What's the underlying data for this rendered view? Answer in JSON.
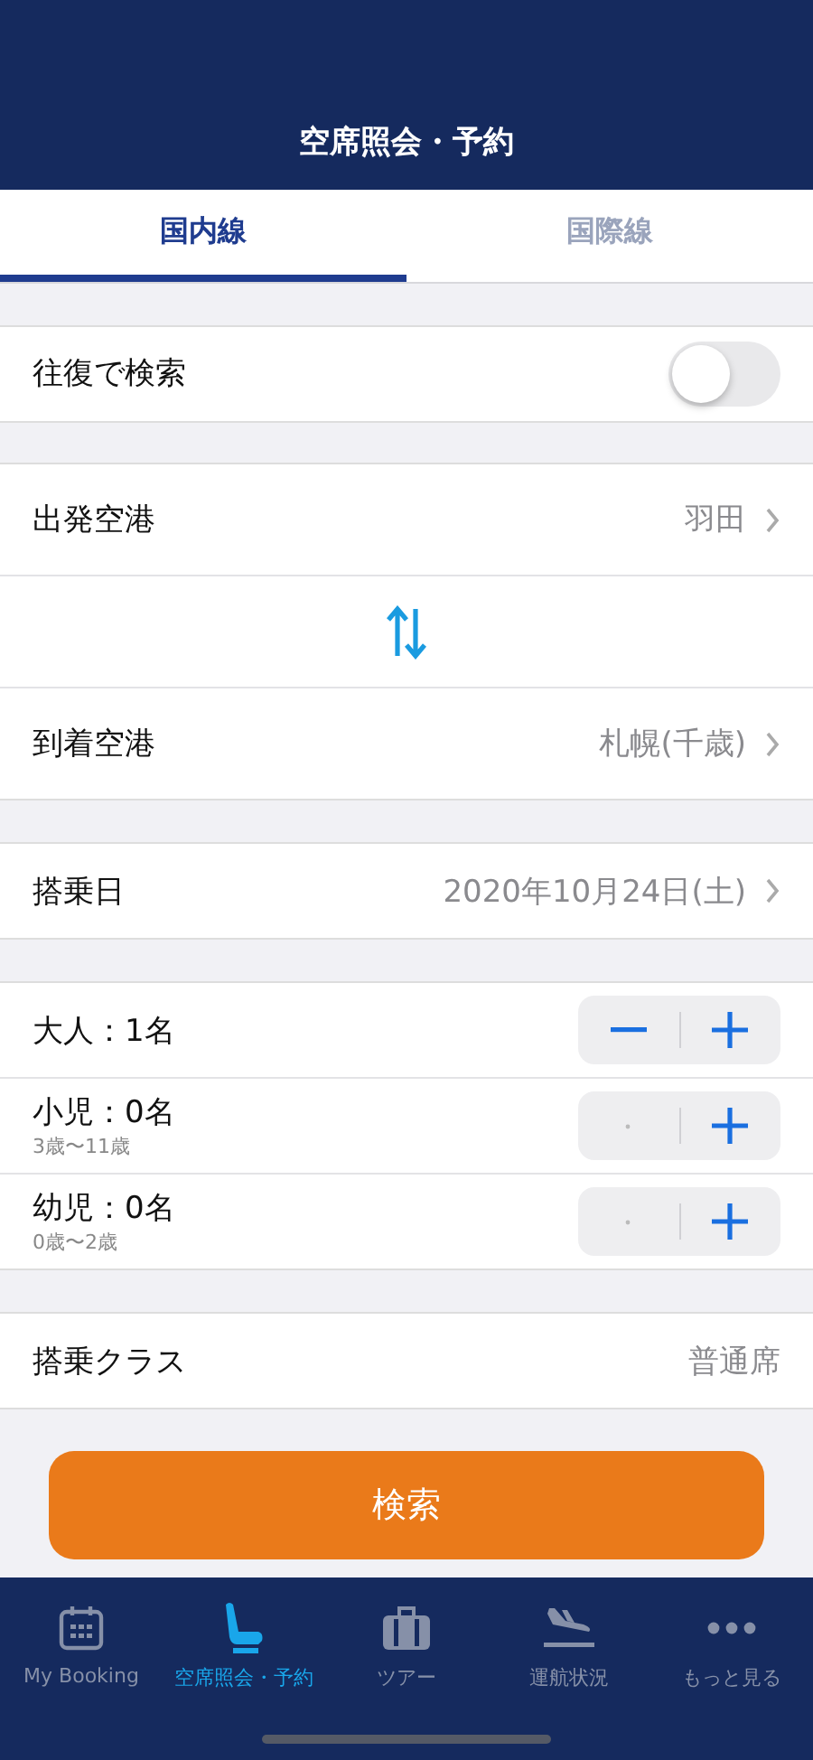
{
  "header": {
    "title": "空席照会・予約"
  },
  "tabs": [
    {
      "label": "国内線",
      "selected": true
    },
    {
      "label": "国際線",
      "selected": false
    }
  ],
  "round_trip": {
    "label": "往復で検索",
    "on": false
  },
  "route": [
    {
      "kind": "field",
      "label": "出発空港",
      "value": "羽田"
    },
    {
      "kind": "swap"
    },
    {
      "kind": "field",
      "label": "到着空港",
      "value": "札幌(千歳)"
    }
  ],
  "date": {
    "label": "搭乗日",
    "value": "2020年10月24日(土)"
  },
  "passengers": [
    {
      "label": "大人：1名",
      "minus_enabled": true
    },
    {
      "label": "小児：0名",
      "note": "3歳〜11歳",
      "minus_enabled": false
    },
    {
      "label": "幼児：0名",
      "note": "0歳〜2歳",
      "minus_enabled": false
    }
  ],
  "cabin_class": {
    "label": "搭乗クラス",
    "value": "普通席"
  },
  "search_button": "検索",
  "tab_bar": [
    {
      "kind": "calendar",
      "label": "My Booking",
      "selected": false
    },
    {
      "kind": "seat",
      "label": "空席照会・予約",
      "selected": true
    },
    {
      "kind": "suitcase",
      "label": "ツアー",
      "selected": false
    },
    {
      "kind": "plane",
      "label": "運航状況",
      "selected": false
    },
    {
      "kind": "more",
      "label": "もっと見る",
      "selected": false
    }
  ]
}
